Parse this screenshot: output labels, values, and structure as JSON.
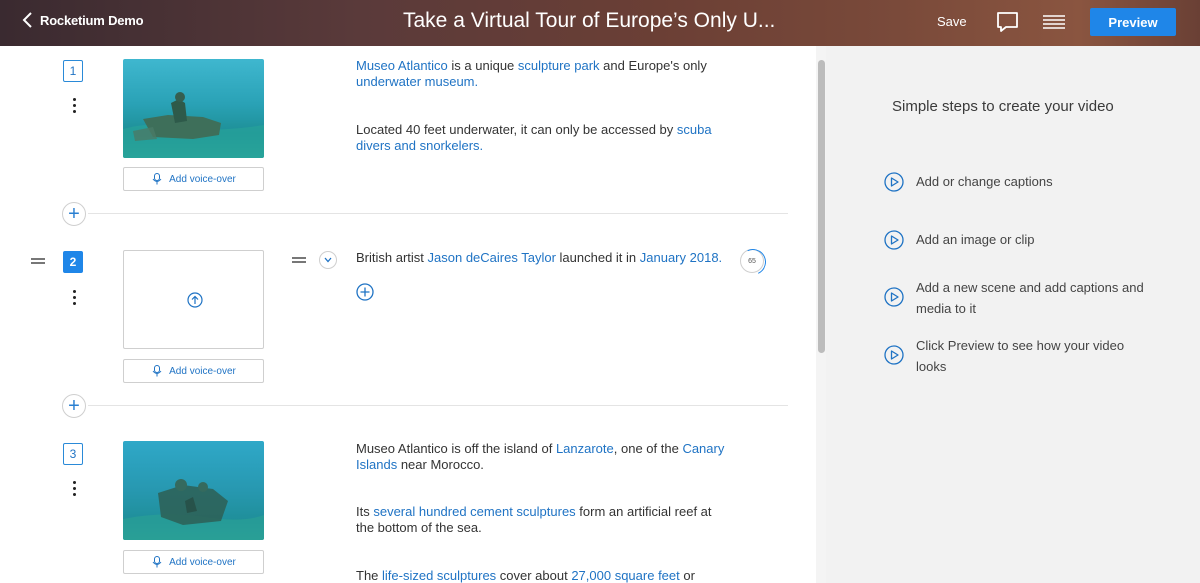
{
  "header": {
    "back_label": "Rocketium Demo",
    "title": "Take a Virtual Tour of Europe’s Only U...",
    "save_label": "Save",
    "preview_label": "Preview"
  },
  "scenes": [
    {
      "number": "1",
      "voice_label": "Add voice-over",
      "captions": [
        [
          {
            "t": "Museo Atlantico",
            "link": true
          },
          {
            "t": " is a unique ",
            "link": false
          },
          {
            "t": "sculpture park",
            "link": true
          },
          {
            "t": " and Europe's only ",
            "link": false
          },
          {
            "t": "underwater museum.",
            "link": true
          }
        ],
        [
          {
            "t": "Located 40 feet underwater, it can only be accessed by ",
            "link": false
          },
          {
            "t": "scuba divers and snorkelers.",
            "link": true
          }
        ]
      ]
    },
    {
      "number": "2",
      "voice_label": "Add voice-over",
      "counter": "65",
      "captions": [
        [
          {
            "t": "British artist ",
            "link": false
          },
          {
            "t": "Jason ",
            "link": true
          },
          {
            "t": "deCaires",
            "link": true,
            "misspelled": true
          },
          {
            "t": " Taylor",
            "link": true
          },
          {
            "t": " launched it in ",
            "link": false
          },
          {
            "t": "January 2018.",
            "link": true
          }
        ]
      ]
    },
    {
      "number": "3",
      "voice_label": "Add voice-over",
      "captions": [
        [
          {
            "t": "Museo Atlantico is off the island of ",
            "link": false
          },
          {
            "t": "Lanzarote",
            "link": true
          },
          {
            "t": ", one of the ",
            "link": false
          },
          {
            "t": "Canary Islands",
            "link": true
          },
          {
            "t": " near Morocco.",
            "link": false
          }
        ],
        [
          {
            "t": "Its ",
            "link": false
          },
          {
            "t": "several hundred cement sculptures",
            "link": true
          },
          {
            "t": " form an artificial reef at the bottom of the sea.",
            "link": false
          }
        ],
        [
          {
            "t": "The ",
            "link": false
          },
          {
            "t": "life-sized sculptures",
            "link": true
          },
          {
            "t": " cover about ",
            "link": false
          },
          {
            "t": "27,000 square feet",
            "link": true
          },
          {
            "t": " or",
            "link": false
          }
        ]
      ]
    }
  ],
  "panel": {
    "title": "Simple steps to create your video",
    "steps": [
      "Add or change captions",
      "Add an image or clip",
      "Add a new scene and add captions and media to it",
      "Click Preview to see how your video looks"
    ]
  },
  "colors": {
    "accent": "#1f86e8",
    "link": "#1f73c4",
    "misspell_underline": "#dd3333"
  }
}
